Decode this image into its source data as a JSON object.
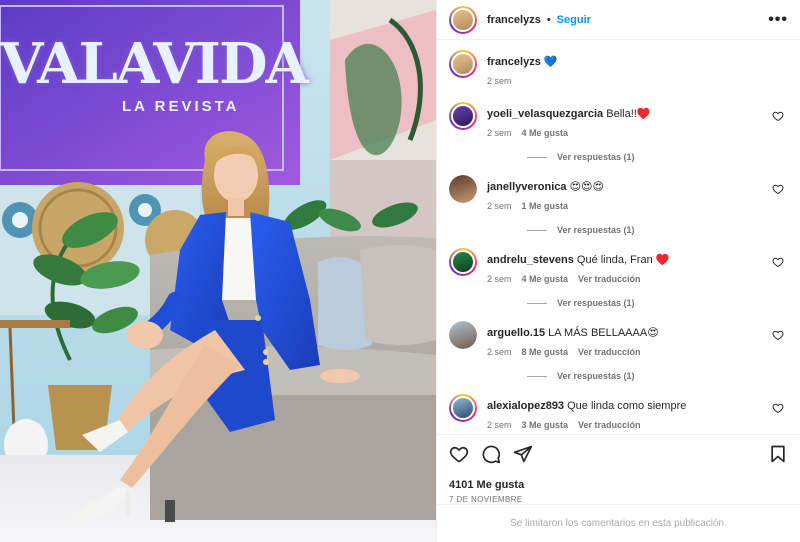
{
  "post": {
    "author": "francelyzs",
    "follow_label": "Seguir",
    "separator": "•",
    "more_label": "•••",
    "sign_title": "VALAVIDA",
    "sign_subtitle": "LA REVISTA"
  },
  "caption": {
    "username": "francelyzs",
    "text": "💙",
    "time": "2 sem"
  },
  "comments": [
    {
      "username": "yoeli_velasquezgarcia",
      "text": "Bella!!♥️",
      "time": "2 sem",
      "likes": "4 Me gusta",
      "translate": "",
      "replies": "Ver respuestas (1)"
    },
    {
      "username": "janellyveronica",
      "text": "😍😍😍",
      "time": "2 sem",
      "likes": "1 Me gusta",
      "translate": "",
      "replies": "Ver respuestas (1)"
    },
    {
      "username": "andrelu_stevens",
      "text": "Qué linda, Fran ♥️",
      "time": "2 sem",
      "likes": "4 Me gusta",
      "translate": "Ver traducción",
      "replies": "Ver respuestas (1)"
    },
    {
      "username": "arguello.15",
      "text": "LA MÁS BELLAAAA😍",
      "time": "2 sem",
      "likes": "8 Me gusta",
      "translate": "Ver traducción",
      "replies": "Ver respuestas (1)"
    },
    {
      "username": "alexialopez893",
      "text": "Que linda como siempre",
      "time": "2 sem",
      "likes": "3 Me gusta",
      "translate": "Ver traducción",
      "replies": ""
    }
  ],
  "actions": {
    "like_count": "4101 Me gusta",
    "date": "7 DE NOVIEMBRE",
    "comments_limited": "Se limitaron los comentarios en esta publicación."
  },
  "colors": {
    "accent": "#0095f6",
    "text": "#262626",
    "muted": "#737373",
    "divider": "#efefef",
    "blazer": "#1f4fd6",
    "sign_bg": "#7b4fe0"
  },
  "icons": [
    "heart-icon",
    "comment-icon",
    "share-icon",
    "bookmark-icon",
    "more-icon"
  ]
}
